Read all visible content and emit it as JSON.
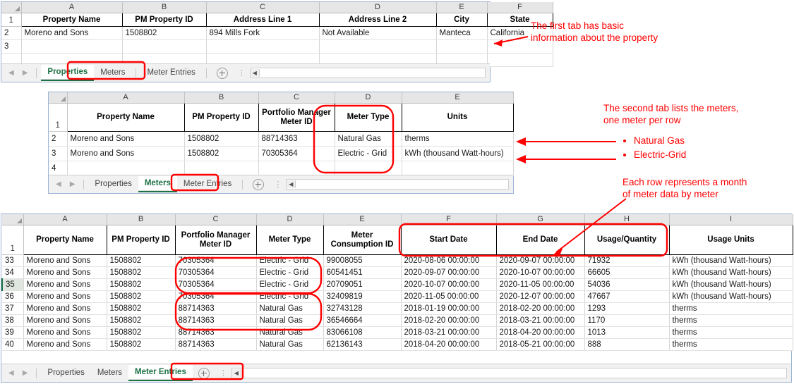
{
  "colors": {
    "accent_green": "#1e7145",
    "annotation_red": "#ff0000",
    "header_grey": "#e6e6e6",
    "sheet_border": "#9ab4d4"
  },
  "sheet1": {
    "name": "properties-sheet",
    "column_letters": [
      "A",
      "B",
      "C",
      "D",
      "E",
      "F"
    ],
    "headers": [
      "Property Name",
      "PM Property ID",
      "Address Line 1",
      "Address Line 2",
      "City",
      "State"
    ],
    "row_numbers": [
      "1",
      "2",
      "3"
    ],
    "rows": [
      [
        "Moreno and Sons",
        "1508802",
        "894 Mills Fork",
        "Not Available",
        "Manteca",
        "California"
      ],
      [
        "",
        "",
        "",
        "",
        "",
        ""
      ]
    ],
    "tabs": [
      {
        "label": "Properties",
        "active": true
      },
      {
        "label": "Meters",
        "active": false
      },
      {
        "label": "Meter Entries",
        "active": false
      }
    ],
    "add_sheet_icon": "plus-circle-icon"
  },
  "sheet2": {
    "name": "meters-sheet",
    "column_letters": [
      "A",
      "B",
      "C",
      "D",
      "E"
    ],
    "headers": [
      "Property Name",
      "PM Property ID",
      "Portfolio Manager Meter ID",
      "Meter Type",
      "Units"
    ],
    "row_numbers": [
      "1",
      "2",
      "3",
      "4"
    ],
    "rows": [
      [
        "Moreno and Sons",
        "1508802",
        "88714363",
        "Natural Gas",
        "therms"
      ],
      [
        "Moreno and Sons",
        "1508802",
        "70305364",
        "Electric - Grid",
        "kWh (thousand Watt-hours)"
      ]
    ],
    "tabs": [
      {
        "label": "Properties",
        "active": false
      },
      {
        "label": "Meters",
        "active": true
      },
      {
        "label": "Meter Entries",
        "active": false
      }
    ],
    "add_sheet_icon": "plus-circle-icon"
  },
  "sheet3": {
    "name": "meter-entries-sheet",
    "column_letters": [
      "A",
      "B",
      "C",
      "D",
      "E",
      "F",
      "G",
      "H",
      "I"
    ],
    "headers": [
      "Property Name",
      "PM Property ID",
      "Portfolio Manager Meter ID",
      "Meter Type",
      "Meter Consumption ID",
      "Start Date",
      "End Date",
      "Usage/Quantity",
      "Usage Units"
    ],
    "row_numbers": [
      "1",
      "33",
      "34",
      "35",
      "36",
      "37",
      "38",
      "39",
      "40"
    ],
    "selected_row": "35",
    "rows": [
      [
        "Moreno and Sons",
        "1508802",
        "70305364",
        "Electric - Grid",
        "99008055",
        "2020-08-06 00:00:00",
        "2020-09-07 00:00:00",
        "71932",
        "kWh (thousand Watt-hours)"
      ],
      [
        "Moreno and Sons",
        "1508802",
        "70305364",
        "Electric - Grid",
        "60541451",
        "2020-09-07 00:00:00",
        "2020-10-07 00:00:00",
        "66605",
        "kWh (thousand Watt-hours)"
      ],
      [
        "Moreno and Sons",
        "1508802",
        "70305364",
        "Electric - Grid",
        "20709051",
        "2020-10-07 00:00:00",
        "2020-11-05 00:00:00",
        "54036",
        "kWh (thousand Watt-hours)"
      ],
      [
        "Moreno and Sons",
        "1508802",
        "70305364",
        "Electric - Grid",
        "32409819",
        "2020-11-05 00:00:00",
        "2020-12-07 00:00:00",
        "47667",
        "kWh (thousand Watt-hours)"
      ],
      [
        "Moreno and Sons",
        "1508802",
        "88714363",
        "Natural Gas",
        "32743128",
        "2018-01-19 00:00:00",
        "2018-02-20 00:00:00",
        "1293",
        "therms"
      ],
      [
        "Moreno and Sons",
        "1508802",
        "88714363",
        "Natural Gas",
        "36546664",
        "2018-02-20 00:00:00",
        "2018-03-21 00:00:00",
        "1170",
        "therms"
      ],
      [
        "Moreno and Sons",
        "1508802",
        "88714363",
        "Natural Gas",
        "83066108",
        "2018-03-21 00:00:00",
        "2018-04-20 00:00:00",
        "1013",
        "therms"
      ],
      [
        "Moreno and Sons",
        "1508802",
        "88714363",
        "Natural Gas",
        "62136143",
        "2018-04-20 00:00:00",
        "2018-05-21 00:00:00",
        "888",
        "therms"
      ]
    ],
    "tabs": [
      {
        "label": "Properties",
        "active": false
      },
      {
        "label": "Meters",
        "active": false
      },
      {
        "label": "Meter Entries",
        "active": true
      }
    ],
    "add_sheet_icon": "plus-circle-icon"
  },
  "annotations": {
    "a1": "The first tab has basic\ninformation about the property",
    "a2": "The second tab lists the meters,\none meter per row",
    "a2_bullets": [
      "Natural Gas",
      "Electric-Grid"
    ],
    "a3": "Each row represents a month\nof meter data by meter"
  }
}
